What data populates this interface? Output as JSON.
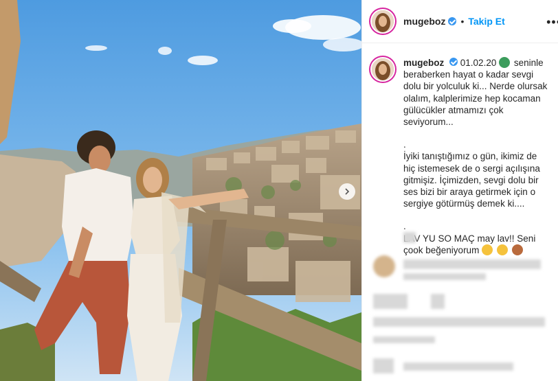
{
  "post": {
    "username": "mugeboz",
    "follow_label": "Takip Et",
    "separator": "•",
    "more_label": "•••",
    "caption": {
      "username": "mugeboz",
      "date": "01.02.20",
      "lines": [
        "seninle beraberken hayat o kadar sevgi dolu bir yolculuk ki... Nerde olursak olalım, kalplerimize hep kocaman gülücükler atmamızı çok seviyorum...",
        ".",
        "İyiki tanıştığımız o gün, ikimiz de hiç istemesek de o sergi açılışına gitmişiz. İçimizden, sevgi dolu bir ses bizi bir araya getirmek için o sergiye götürmüş demek ki....",
        ".",
        "LAV YU SO MAÇ may lav!! Seni çook beğeniyorum"
      ]
    }
  },
  "colors": {
    "link_blue": "#0095f6",
    "verified_blue": "#3897f0",
    "text": "#262626",
    "story_ring": "#d6249f"
  },
  "icons": [
    "verified-badge-icon",
    "chevron-right-icon",
    "smiling-face-emoji-icon",
    "couple-emoji-icon"
  ]
}
